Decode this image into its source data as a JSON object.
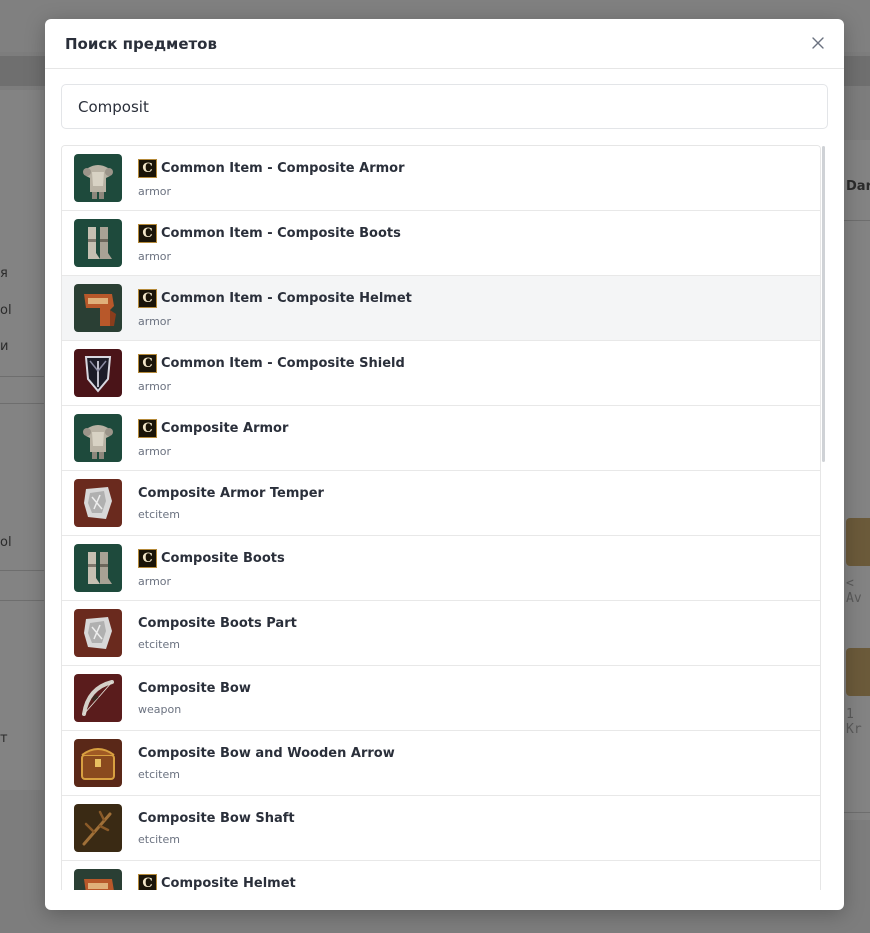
{
  "background": {
    "left_texts": [
      "я",
      "ol",
      "и",
      "ol",
      "т"
    ],
    "right_texts": [
      "Dar",
      "< Av",
      "1 Kr"
    ]
  },
  "modal": {
    "title": "Поиск предметов",
    "close_icon": "close-icon"
  },
  "search": {
    "value": "Composit",
    "placeholder": ""
  },
  "results": [
    {
      "grade": "C",
      "name": "Common Item - Composite Armor",
      "type": "armor",
      "icon": "plate-armor-icon"
    },
    {
      "grade": "C",
      "name": "Common Item - Composite Boots",
      "type": "armor",
      "icon": "boots-icon"
    },
    {
      "grade": "C",
      "name": "Common Item - Composite Helmet",
      "type": "armor",
      "icon": "helmet-icon"
    },
    {
      "grade": "C",
      "name": "Common Item - Composite Shield",
      "type": "armor",
      "icon": "shield-icon"
    },
    {
      "grade": "C",
      "name": "Composite Armor",
      "type": "armor",
      "icon": "plate-armor-icon"
    },
    {
      "grade": "",
      "name": "Composite Armor Temper",
      "type": "etcitem",
      "icon": "temper-icon"
    },
    {
      "grade": "C",
      "name": "Composite Boots",
      "type": "armor",
      "icon": "boots-icon"
    },
    {
      "grade": "",
      "name": "Composite Boots Part",
      "type": "etcitem",
      "icon": "temper-icon"
    },
    {
      "grade": "",
      "name": "Composite Bow",
      "type": "weapon",
      "icon": "bow-icon"
    },
    {
      "grade": "",
      "name": "Composite Bow and Wooden Arrow",
      "type": "etcitem",
      "icon": "chest-icon"
    },
    {
      "grade": "",
      "name": "Composite Bow Shaft",
      "type": "etcitem",
      "icon": "branch-icon"
    },
    {
      "grade": "C",
      "name": "Composite Helmet",
      "type": "armor",
      "icon": "helmet-icon"
    }
  ],
  "hovered_index": 2,
  "colors": {
    "overlay": "#7d7d7d",
    "modal_bg": "#ffffff",
    "hover_row": "#f4f5f6",
    "grade_badge": "#1a1408",
    "grade_border": "#b58a3a"
  }
}
